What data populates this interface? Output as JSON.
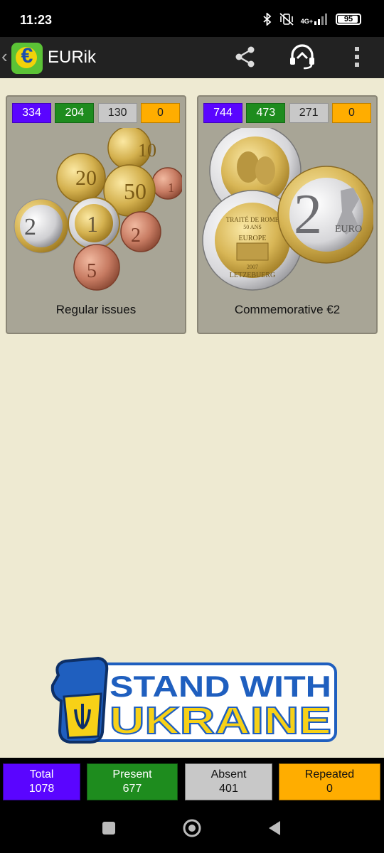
{
  "status": {
    "time": "11:23",
    "network": "4G+",
    "battery": "95",
    "battery_level": 0.95
  },
  "app": {
    "title": "EURik",
    "logo_symbol": "€"
  },
  "categories": [
    {
      "label": "Regular issues",
      "total": "334",
      "present": "204",
      "absent": "130",
      "repeated": "0",
      "image_numerals": [
        "10",
        "20",
        "50",
        "1",
        "1",
        "2",
        "2",
        "5"
      ]
    },
    {
      "label": "Commemorative €2",
      "total": "744",
      "present": "473",
      "absent": "271",
      "repeated": "0",
      "image_numerals": [
        "2",
        "EURO",
        "TRAITÉ DE ROME",
        "50 ANS",
        "EUROPE",
        "2007",
        "LETZEBUERG",
        "2"
      ]
    }
  ],
  "banner": {
    "line1": "STAND WITH",
    "line2": "UKRAINE"
  },
  "summary": {
    "total_label": "Total",
    "total_value": "1078",
    "present_label": "Present",
    "present_value": "677",
    "absent_label": "Absent",
    "absent_value": "401",
    "repeated_label": "Repeated",
    "repeated_value": "0"
  },
  "colors": {
    "total": "#5a05ff",
    "present": "#1e8c1e",
    "absent": "#c8c8c8",
    "repeated": "#ffad00",
    "background": "#eeead2",
    "appbar": "#222222",
    "banner_blue": "#1f5fbf",
    "banner_yellow": "#f7d117"
  },
  "icons": {
    "back": "chevron-left-icon",
    "share": "share-icon",
    "support": "headset-icon",
    "menu": "more-vert-icon",
    "bluetooth": "bluetooth-icon",
    "mute": "vibrate-off-icon",
    "signal": "signal-icon",
    "nav_recents": "square-icon",
    "nav_home": "circle-icon",
    "nav_back": "triangle-back-icon"
  }
}
